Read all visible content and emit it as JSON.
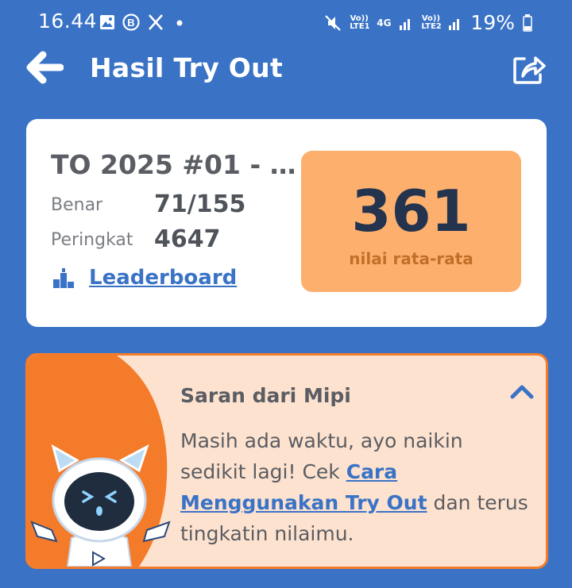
{
  "status_bar": {
    "time": "16.44",
    "battery": "19%",
    "sim1_label": "Vo)) LTE1",
    "net_label": "4G",
    "sim2_label": "Vo)) LTE2"
  },
  "app_bar": {
    "title": "Hasil Try Out",
    "back_icon": "arrow-left-icon",
    "share_icon": "share-icon"
  },
  "result": {
    "title": "TO 2025 #01 - S...",
    "correct_label": "Benar",
    "correct_value": "71/155",
    "rank_label": "Peringkat",
    "rank_value": "4647",
    "leaderboard_link": "Leaderboard",
    "score": "361",
    "score_caption": "nilai rata-rata"
  },
  "advice": {
    "title": "Saran dari Mipi",
    "text_before": "Masih ada waktu, ayo naikin sedikit lagi! Cek ",
    "link": "Cara Menggunakan Try Out",
    "text_after": " dan terus tingkatin nilaimu."
  },
  "colors": {
    "background": "#3a73c6",
    "score_box": "#fdb06d",
    "accent_orange": "#f47b2a",
    "advice_bg": "#fde2cf",
    "link": "#3a73c6"
  }
}
